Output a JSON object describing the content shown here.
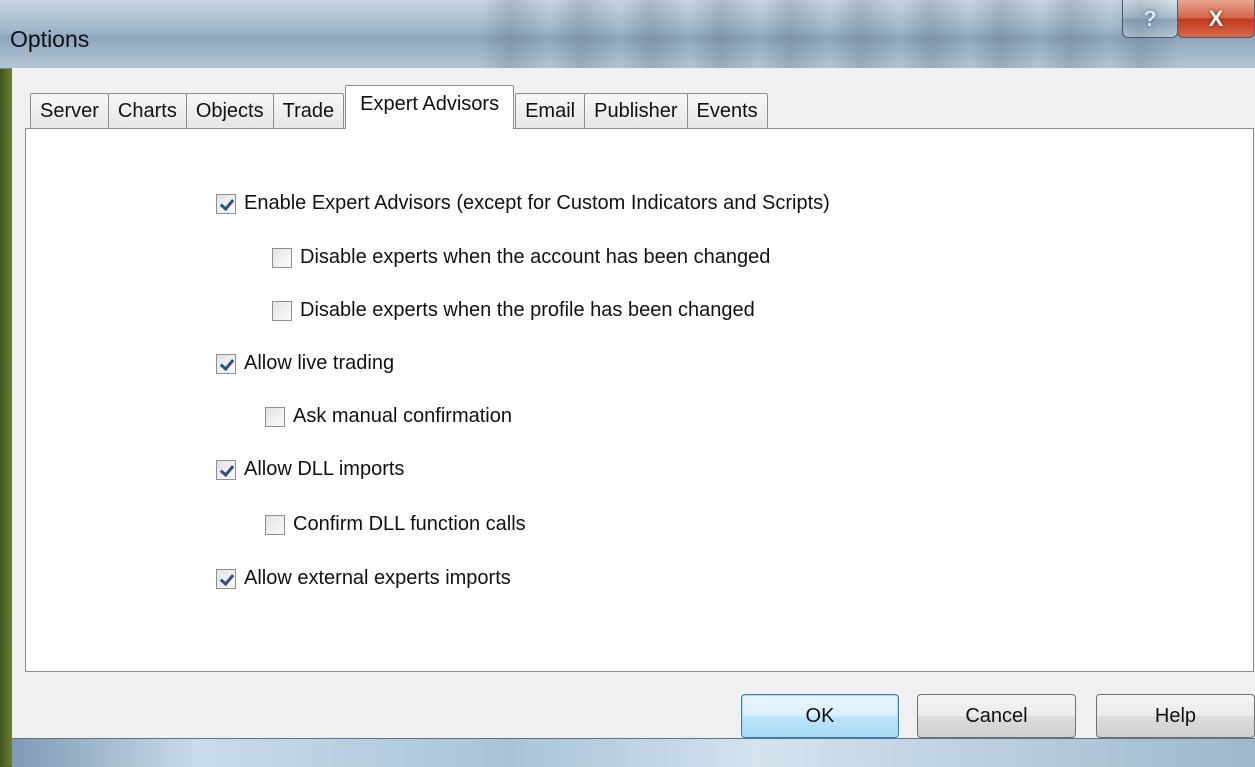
{
  "window": {
    "title": "Options"
  },
  "caption_buttons": {
    "help": "?",
    "close": "X"
  },
  "tabs": [
    {
      "label": "Server",
      "active": false
    },
    {
      "label": "Charts",
      "active": false
    },
    {
      "label": "Objects",
      "active": false
    },
    {
      "label": "Trade",
      "active": false
    },
    {
      "label": "Expert Advisors",
      "active": true
    },
    {
      "label": "Email",
      "active": false
    },
    {
      "label": "Publisher",
      "active": false
    },
    {
      "label": "Events",
      "active": false
    }
  ],
  "options": [
    {
      "label": "Enable Expert Advisors (except for Custom Indicators and Scripts)",
      "checked": true
    },
    {
      "label": "Disable experts when the account has been changed",
      "checked": false
    },
    {
      "label": "Disable experts when the profile has been changed",
      "checked": false
    },
    {
      "label": "Allow live trading",
      "checked": true
    },
    {
      "label": "Ask manual confirmation",
      "checked": false
    },
    {
      "label": "Allow DLL imports",
      "checked": true
    },
    {
      "label": "Confirm DLL function calls",
      "checked": false
    },
    {
      "label": "Allow external experts imports",
      "checked": true
    }
  ],
  "buttons": {
    "ok": "OK",
    "cancel": "Cancel",
    "help": "Help"
  }
}
